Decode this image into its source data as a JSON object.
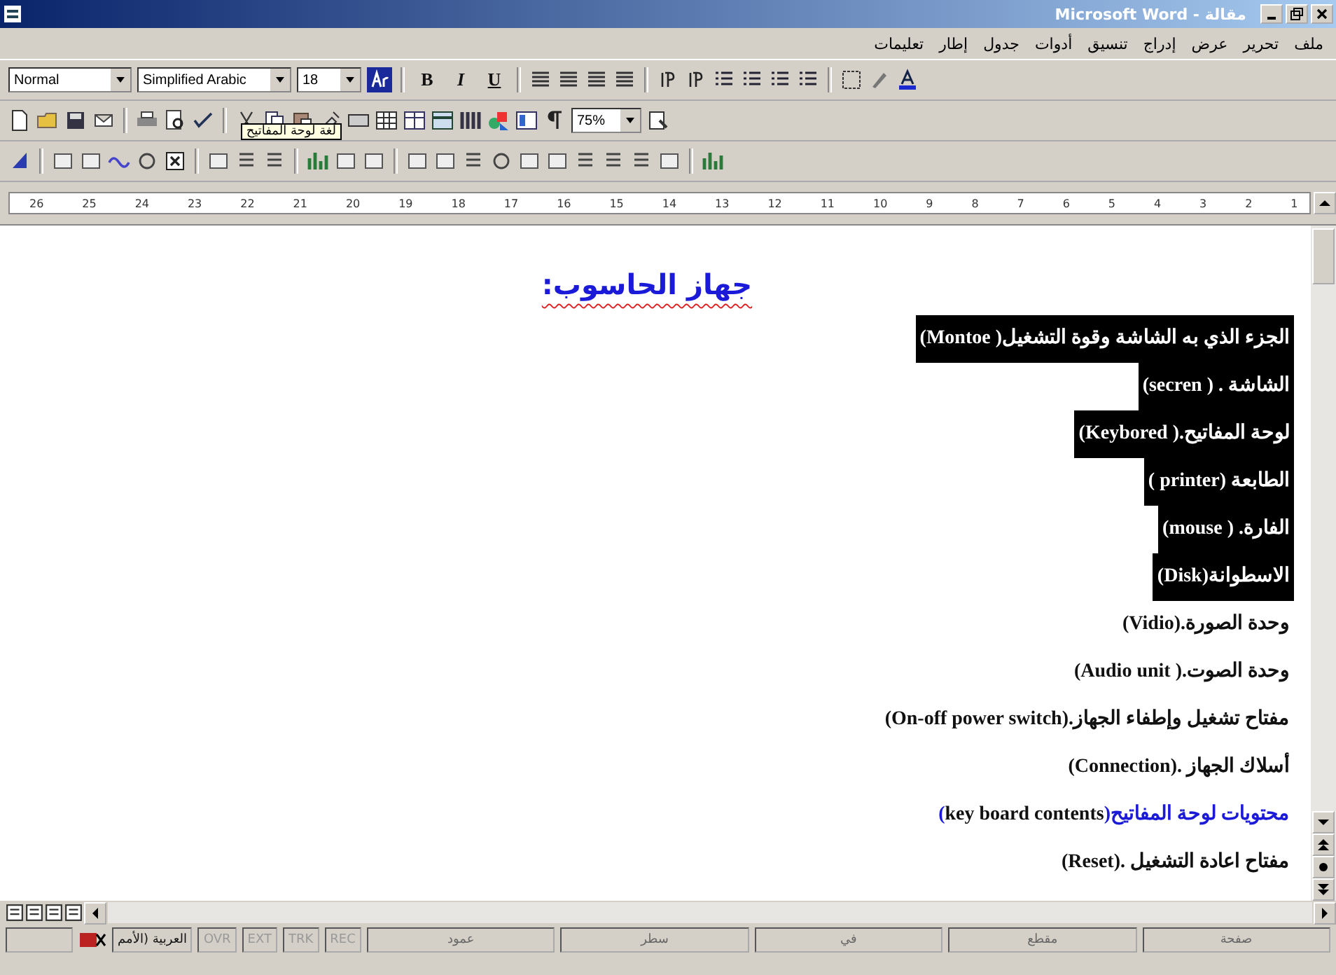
{
  "window": {
    "title": "Microsoft Word - مقالة"
  },
  "menu": [
    {
      "label": "ملف"
    },
    {
      "label": "تحرير"
    },
    {
      "label": "عرض"
    },
    {
      "label": "إدراج"
    },
    {
      "label": "تنسيق"
    },
    {
      "label": "أدوات"
    },
    {
      "label": "جدول"
    },
    {
      "label": "إطار"
    },
    {
      "label": "تعليمات"
    }
  ],
  "formatting": {
    "style": "Normal",
    "font": "Simplified Arabic",
    "size": "18",
    "bold": "B",
    "italic": "I",
    "underline": "U"
  },
  "standard": {
    "tooltip": "لغة لوحة المفاتيح",
    "zoom": "75%"
  },
  "ruler": [
    "1",
    "2",
    "3",
    "4",
    "5",
    "6",
    "7",
    "8",
    "9",
    "10",
    "11",
    "12",
    "13",
    "14",
    "15",
    "16",
    "17",
    "18",
    "19",
    "20",
    "21",
    "22",
    "23",
    "24",
    "25",
    "26"
  ],
  "document": {
    "heading": "جهاز الحاسوب:",
    "lines": [
      {
        "kind": "item",
        "text": "الجزء الذي به الشاشة وقوة التشغيل( **Montoe**)",
        "highlighted": true
      },
      {
        "kind": "item",
        "text": "الشاشة . ( **secren**)",
        "highlighted": true
      },
      {
        "kind": "item",
        "text": "لوحة المفاتيح.( **Keybored**)",
        "highlighted": true
      },
      {
        "kind": "item",
        "text": "الطابعة (**printer** )",
        "highlighted": true
      },
      {
        "kind": "item",
        "text": "الفارة. ( **mouse**)",
        "highlighted": true
      },
      {
        "kind": "item",
        "text": "الاسطوانة(**Disk**)",
        "highlighted": true
      },
      {
        "kind": "item",
        "text": "وحدة الصورة.(**Vidio**)",
        "highlighted": false
      },
      {
        "kind": "item",
        "text": "وحدة الصوت.( **Audio unit**)",
        "highlighted": false
      },
      {
        "kind": "item",
        "text": "مفتاح تشغيل وإطفاء الجهاز.(**On-off power switch**)",
        "highlighted": false
      },
      {
        "kind": "item",
        "text": "أسلاك الجهاز .(**Connection**)",
        "highlighted": false
      },
      {
        "kind": "subheading",
        "text": "محتويات لوحة المفاتيح(**key board contents**)",
        "highlighted": false
      },
      {
        "kind": "item",
        "text": "مفتاح اعادة التشغيل .(**Reset**)",
        "highlighted": false
      }
    ]
  },
  "status_bar": {
    "fields": [
      "صفحة",
      "مقطع",
      "في",
      "سطر",
      "عمود"
    ],
    "modes": [
      "REC",
      "TRK",
      "EXT",
      "OVR"
    ],
    "language": "العربية (الأمم"
  }
}
